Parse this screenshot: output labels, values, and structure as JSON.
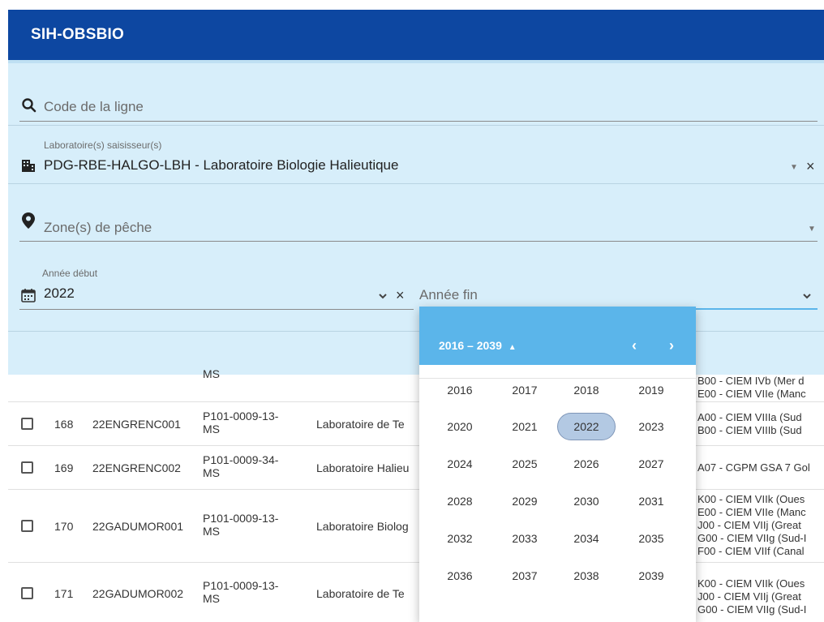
{
  "app": {
    "title": "SIH-OBSBIO"
  },
  "filters": {
    "code_placeholder": "Code de la ligne",
    "lab_label": "Laboratoire(s) saisisseur(s)",
    "lab_value": "PDG-RBE-HALGO-LBH - Laboratoire Biologie Halieutique",
    "zone_placeholder": "Zone(s) de pêche",
    "start_year_label": "Année début",
    "start_year_value": "2022",
    "end_year_placeholder": "Année fin",
    "clear_symbol": "×"
  },
  "table": {
    "partial_top": {
      "col3": "MS",
      "zone": [
        "B00 - CIEM IVb (Mer d",
        "E00 - CIEM VIIe (Manc"
      ]
    },
    "rows": [
      {
        "id": "168",
        "code": "22ENGRENC001",
        "ref": [
          "P101-0009-13-",
          "MS"
        ],
        "lab": "Laboratoire de Te",
        "zones": [
          "A00 - CIEM VIIIa (Sud",
          "B00 - CIEM VIIIb (Sud"
        ]
      },
      {
        "id": "169",
        "code": "22ENGRENC002",
        "ref": [
          "P101-0009-34-",
          "MS"
        ],
        "lab": "Laboratoire Halieu",
        "zones": [
          "A07 - CGPM GSA 7 Gol"
        ]
      },
      {
        "id": "170",
        "code": "22GADUMOR001",
        "ref": [
          "P101-0009-13-",
          "MS"
        ],
        "lab": "Laboratoire Biolog",
        "zones": [
          "K00 - CIEM VIIk (Oues",
          "E00 - CIEM VIIe (Manc",
          "J00 - CIEM VIIj (Great",
          "G00 - CIEM VIIg (Sud-I",
          "F00 - CIEM VIIf (Canal"
        ]
      },
      {
        "id": "171",
        "code": "22GADUMOR002",
        "ref": [
          "P101-0009-13-",
          "MS"
        ],
        "lab": "Laboratoire de Te",
        "zones": [
          "K00 - CIEM VIIk (Oues",
          "J00 - CIEM VIIj (Great",
          "G00 - CIEM VIIg (Sud-I"
        ]
      }
    ]
  },
  "picker": {
    "range_label": "2016 – 2039",
    "selected_year": "2022",
    "prev_symbol": "‹",
    "next_symbol": "›",
    "years": [
      "2016",
      "2017",
      "2018",
      "2019",
      "2020",
      "2021",
      "2022",
      "2023",
      "2024",
      "2025",
      "2026",
      "2027",
      "2028",
      "2029",
      "2030",
      "2031",
      "2032",
      "2033",
      "2034",
      "2035",
      "2036",
      "2037",
      "2038",
      "2039"
    ]
  },
  "colors": {
    "toolbar": "#0d47a1",
    "panel": "#d7eefa",
    "picker_header": "#5bb5ea",
    "selected_year": "#b3c9e3"
  }
}
